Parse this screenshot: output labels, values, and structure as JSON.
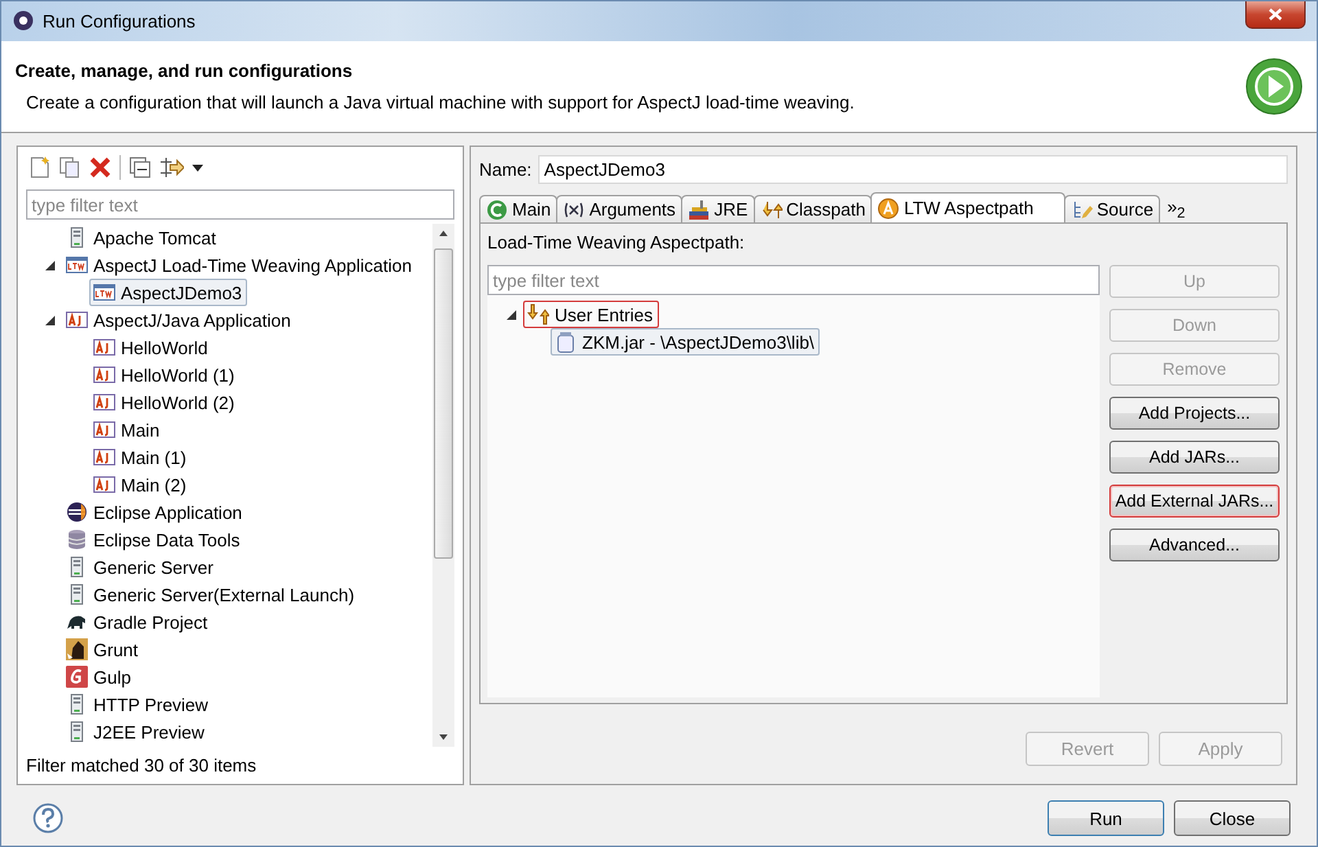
{
  "window": {
    "title": "Run Configurations"
  },
  "header": {
    "title": "Create, manage, and run configurations",
    "description": "Create a configuration that will launch a Java virtual machine with support for AspectJ load-time weaving."
  },
  "left": {
    "filter": {
      "placeholder": "type filter text"
    },
    "tree": [
      {
        "label": "Apache Tomcat",
        "kind": "server"
      },
      {
        "label": "AspectJ Load-Time Weaving Application",
        "kind": "ltw",
        "expanded": true,
        "children": [
          {
            "label": "AspectJDemo3",
            "kind": "ltw",
            "selected": true
          }
        ]
      },
      {
        "label": "AspectJ/Java Application",
        "kind": "aj",
        "expanded": true,
        "children": [
          {
            "label": "HelloWorld",
            "kind": "aj",
            "selected": false
          },
          {
            "label": "HelloWorld (1)",
            "kind": "aj",
            "selected": false
          },
          {
            "label": "HelloWorld (2)",
            "kind": "aj",
            "selected": false
          },
          {
            "label": "Main",
            "kind": "aj",
            "selected": false
          },
          {
            "label": "Main (1)",
            "kind": "aj",
            "selected": false
          },
          {
            "label": "Main (2)",
            "kind": "aj",
            "selected": false
          }
        ]
      },
      {
        "label": "Eclipse Application",
        "kind": "eclipse"
      },
      {
        "label": "Eclipse Data Tools",
        "kind": "database"
      },
      {
        "label": "Generic Server",
        "kind": "server"
      },
      {
        "label": "Generic Server(External Launch)",
        "kind": "server"
      },
      {
        "label": "Gradle Project",
        "kind": "gradle"
      },
      {
        "label": "Grunt",
        "kind": "grunt"
      },
      {
        "label": "Gulp",
        "kind": "gulp"
      },
      {
        "label": "HTTP Preview",
        "kind": "server"
      },
      {
        "label": "J2EE Preview",
        "kind": "server"
      }
    ],
    "status": "Filter matched 30 of 30 items"
  },
  "right": {
    "name_label": "Name:",
    "name_value": "AspectJDemo3",
    "tabs": [
      {
        "label": "Main",
        "kind": "main",
        "selected": false
      },
      {
        "label": "Arguments",
        "kind": "args",
        "selected": false
      },
      {
        "label": "JRE",
        "kind": "jre",
        "selected": false
      },
      {
        "label": "Classpath",
        "kind": "classpath",
        "selected": false
      },
      {
        "label": "LTW Aspectpath",
        "kind": "aspect",
        "selected": true
      },
      {
        "label": "Source",
        "kind": "source",
        "selected": false
      }
    ],
    "tab_overflow": "»$_{2}$",
    "section_label": "Load-Time Weaving Aspectpath:",
    "filter": {
      "placeholder": "type filter text"
    },
    "entries": [
      {
        "label": "User Entries",
        "kind": "entries",
        "expanded": true,
        "highlighted": true,
        "children": [
          {
            "label": "ZKM.jar - \\AspectJDemo3\\lib\\",
            "kind": "jar",
            "highlighted": false
          }
        ]
      }
    ],
    "side_buttons": [
      {
        "label": "Up",
        "disabled": true,
        "highlighted": false
      },
      {
        "label": "Down",
        "disabled": true,
        "highlighted": false
      },
      {
        "label": "Remove",
        "disabled": true,
        "highlighted": false
      },
      {
        "label": "Add Projects...",
        "disabled": false,
        "highlighted": false
      },
      {
        "label": "Add JARs...",
        "disabled": false,
        "highlighted": false
      },
      {
        "label": "Add External JARs...",
        "disabled": false,
        "highlighted": true
      },
      {
        "label": "Advanced...",
        "disabled": false,
        "highlighted": false
      }
    ],
    "apply_buttons": [
      {
        "label": "Revert",
        "disabled": true
      },
      {
        "label": "Apply",
        "disabled": true
      }
    ]
  },
  "footer": {
    "buttons": [
      {
        "label": "Run",
        "default": true
      },
      {
        "label": "Close",
        "default": false
      }
    ]
  }
}
